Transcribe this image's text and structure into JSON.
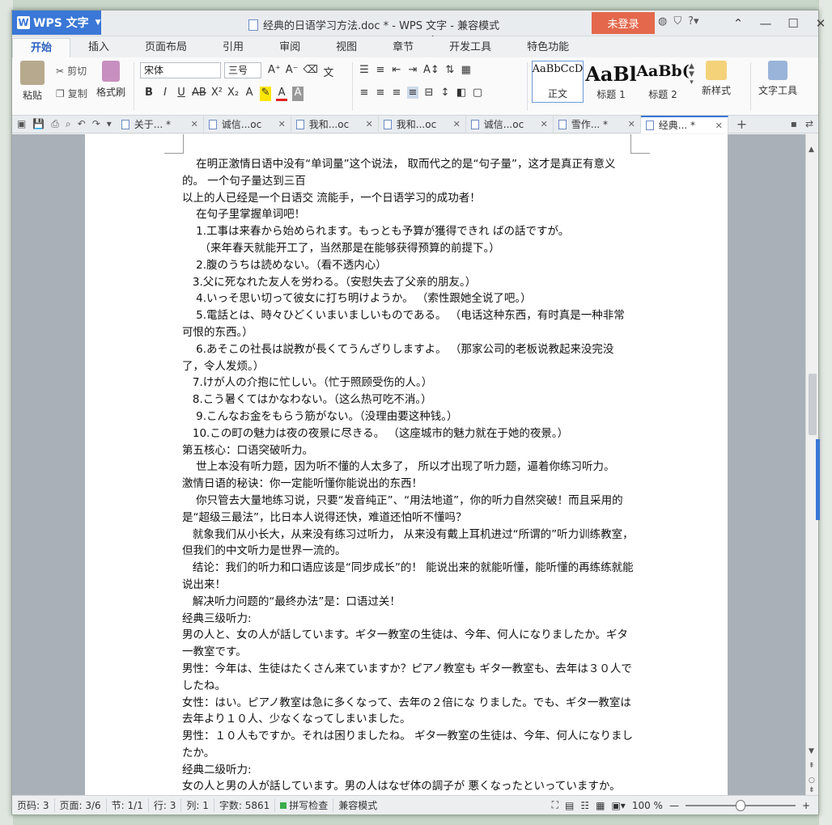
{
  "titlebar": {
    "app_name": "WPS 文字",
    "doc_title": "经典的日语学习方法.doc * - WPS 文字 - 兼容模式",
    "login": "未登录"
  },
  "ribbon_tabs": [
    "开始",
    "插入",
    "页面布局",
    "引用",
    "审阅",
    "视图",
    "章节",
    "开发工具",
    "特色功能"
  ],
  "ribbon": {
    "paste": "粘贴",
    "cut": "剪切",
    "copy": "复制",
    "format_painter": "格式刷",
    "font_name": "宋体",
    "font_size": "三号",
    "styles": [
      {
        "sample": "AaBbCcD",
        "name": "正文"
      },
      {
        "sample": "AaBl",
        "name": "标题 1"
      },
      {
        "sample": "AaBb(",
        "name": "标题 2"
      }
    ],
    "new_style": "新样式",
    "text_tools": "文字工具"
  },
  "doc_tabs": [
    {
      "label": "关于... *",
      "active": false
    },
    {
      "label": "诚信...oc",
      "active": false
    },
    {
      "label": "我和...oc",
      "active": false
    },
    {
      "label": "我和...oc",
      "active": false
    },
    {
      "label": "诚信...oc",
      "active": false
    },
    {
      "label": "雪作... *",
      "active": false
    },
    {
      "label": "经典... *",
      "active": true
    }
  ],
  "document": {
    "lines": [
      "    在明正激情日语中没有“单词量”这个说法， 取而代之的是“句子量”，这才是真正有意义的。 一个句子量达到三百",
      "以上的人已经是一个日语交 流能手，一个日语学习的成功者！",
      "    在句子里掌握单词吧！",
      "    1.工事は来春から始められます。もっとも予算が獲得できれ ばの話ですが。",
      "     （来年春天就能开工了，当然那是在能够获得预算的前提下。）",
      "    2.腹のうちは読めない。（看不透内心）",
      "   3.父に死なれた友人を労わる。（安慰失去了父亲的朋友。）",
      "    4.いっそ思い切って彼女に打ち明けようか。 （索性跟她全说了吧。）",
      "    5.電話とは、時々ひどくいまいましいものである。 （电话这种东西，有时真是一种非常可恨的东西。）",
      "    6.あそこの社長は説教が長くてうんざりしますよ。 （那家公司的老板说教起来没完没了，令人发烦。）",
      "   7.けが人の介抱に忙しい。（忙于照顾受伤的人。）",
      "   8.こう暑くてはかなわない。（这么热可吃不消。）",
      "    9.こんなお金をもらう筋がない。（没理由要这种钱。）",
      "   10.この町の魅力は夜の夜景に尽きる。 （这座城市的魅力就在于她的夜景。）",
      "第五核心：口语突破听力。",
      "    世上本没有听力题，因为听不懂的人太多了， 所以才出现了听力题，逼着你练习听力。",
      "激情日语的秘诀：你一定能听懂你能说出的东西！",
      "    你只管去大量地练习说，只要“发音纯正”、“用法地道”，你的听力自然突破！而且采用的是“超级三最法”，比日本人说得还快，难道还怕听不懂吗？",
      "   就象我们从小长大，从来没有练习过听力， 从来没有戴上耳机进过“所谓的”听力训练教室， 但我们的中文听力是世界一流的。",
      "   结论：我们的听力和口语应该是“同步成长”的！ 能说出来的就能听懂，能听懂的再练练就能说出来！",
      "   解决听力问题的“最终办法”是：口语过关！",
      "经典三级听力:",
      "男の人と、女の人が話しています。ギタ一教室の生徒は、今年、何人になりましたか。ギタ一教室です。",
      "男性：今年は、生徒はたくさん来ていますか？ピアノ教室も ギタ一教室も、去年は３０人でしたね。",
      "女性：はい。ピアノ教室は急に多くなって、去年の２倍にな りました。でも、ギタ一教室は去年より１０人、少なくなってしまいました。",
      "男性：１０人もですか。それは困りましたね。 ギタ一教室の生徒は、今年、何人になりましたか。",
      "经典二级听力:",
      "女の人と男の人が話しています。男の人はなぜ体の調子が 悪くなったといっていますか。"
    ]
  },
  "statusbar": {
    "page_num": "页码: 3",
    "pages": "页面: 3/6",
    "section": "节: 1/1",
    "row": "行: 3",
    "col": "列: 1",
    "word_count": "字数: 5861",
    "spell_check": "拼写检查",
    "compat_mode": "兼容模式",
    "zoom": "100 %"
  },
  "colors": {
    "app_blue": "#3a77d6",
    "login_red": "#e4684c"
  }
}
